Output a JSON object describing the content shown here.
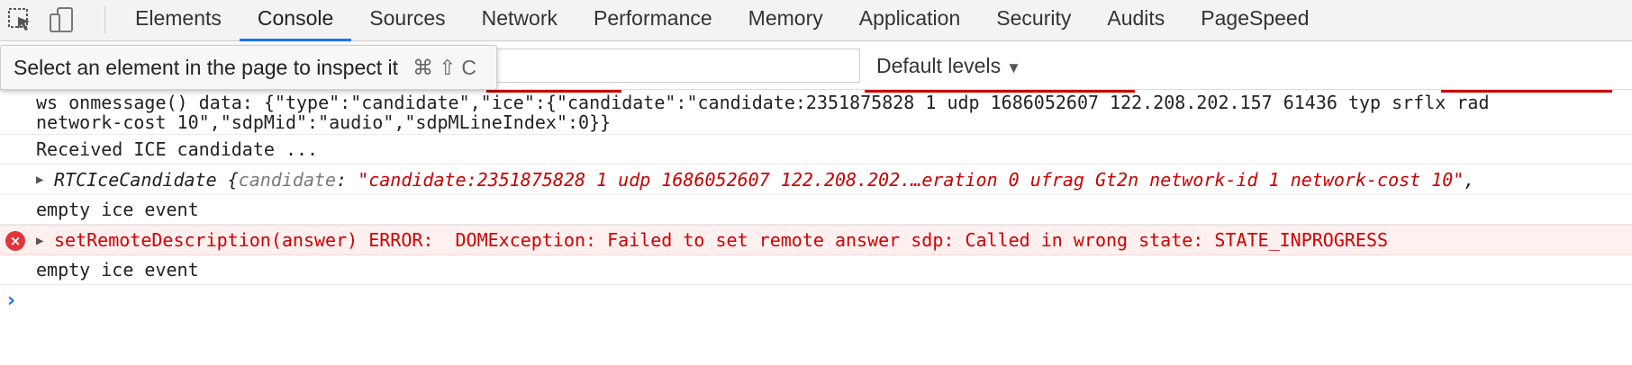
{
  "toolbar": {
    "inspect_icon": "inspect-element-icon",
    "device_icon": "device-toolbar-icon",
    "tabs": [
      {
        "label": "Elements",
        "active": false
      },
      {
        "label": "Console",
        "active": true
      },
      {
        "label": "Sources",
        "active": false
      },
      {
        "label": "Network",
        "active": false
      },
      {
        "label": "Performance",
        "active": false
      },
      {
        "label": "Memory",
        "active": false
      },
      {
        "label": "Application",
        "active": false
      },
      {
        "label": "Security",
        "active": false
      },
      {
        "label": "Audits",
        "active": false
      },
      {
        "label": "PageSpeed",
        "active": false
      }
    ]
  },
  "filter": {
    "value": "",
    "levels_label": "Default levels",
    "levels_arrow": "▼"
  },
  "tooltip": {
    "text": "Select an element in the page to inspect it",
    "shortcut": "⌘⇧C"
  },
  "console": {
    "messages": [
      {
        "type": "log",
        "lines": [
          "ws onmessage() data: {\"type\":\"candidate\",\"ice\":{\"candidate\":\"candidate:2351875828 1 udp 1686052607 122.208.202.157 61436 typ srflx rad",
          "network-cost 10\",\"sdpMid\":\"audio\",\"sdpMLineIndex\":0}}"
        ]
      },
      {
        "type": "log",
        "text": "Received ICE candidate ..."
      },
      {
        "type": "object",
        "name": "RTCIceCandidate",
        "brace": " {",
        "key": "candidate",
        "colon": ": ",
        "value": "\"candidate:2351875828 1 udp 1686052607 122.208.202.…eration 0 ufrag Gt2n network-id 1 network-cost 10\"",
        "trail": ","
      },
      {
        "type": "log",
        "text": "empty ice event"
      },
      {
        "type": "error",
        "text": "setRemoteDescription(answer) ERROR:  DOMException: Failed to set remote answer sdp: Called in wrong state: STATE_INPROGRESS"
      },
      {
        "type": "log",
        "text": "empty ice event"
      }
    ],
    "prompt": "›"
  },
  "colors": {
    "accent": "#1a73e8",
    "error": "#d00000",
    "error_bg": "#fff0f0",
    "string": "#c80000"
  }
}
